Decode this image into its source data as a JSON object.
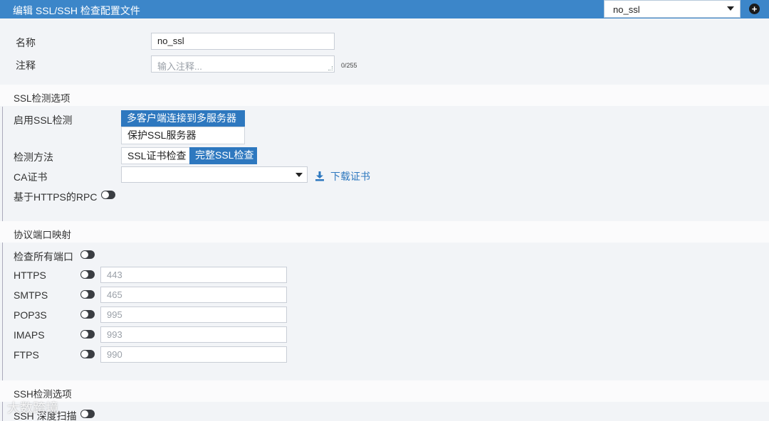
{
  "header": {
    "title": "编辑 SSL/SSH 检查配置文件",
    "profile_select_value": "no_ssl",
    "add_label": "+"
  },
  "form": {
    "name_label": "名称",
    "name_value": "no_ssl",
    "comment_label": "注释",
    "comment_placeholder": "输入注释...",
    "comment_counter": "0/255"
  },
  "ssl_section": {
    "title": "SSL检测选项",
    "enable_label": "启用SSL检测",
    "enable_options": [
      "多客户端连接到多服务器",
      "保护SSL服务器"
    ],
    "enable_selected": "多客户端连接到多服务器",
    "method_label": "检测方法",
    "method_options": [
      "SSL证书检查",
      "完整SSL检查"
    ],
    "method_selected": "完整SSL检查",
    "ca_label": "CA证书",
    "ca_value": "",
    "download_label": "下载证书",
    "rpc_label": "基于HTTPS的RPC"
  },
  "port_section": {
    "title": "协议端口映射",
    "all_ports_label": "检查所有端口",
    "protocols": [
      {
        "name": "HTTPS",
        "port": "443"
      },
      {
        "name": "SMTPS",
        "port": "465"
      },
      {
        "name": "POP3S",
        "port": "995"
      },
      {
        "name": "IMAPS",
        "port": "993"
      },
      {
        "name": "FTPS",
        "port": "990"
      }
    ]
  },
  "ssh_section": {
    "title": "SSH检测选项",
    "deep_scan_label": "SSH 深度扫描"
  },
  "watermark": "大数跨境",
  "colors": {
    "header_bg": "#3c86c9",
    "active_option": "#2e78bf",
    "toggle_off": "#3a3d42",
    "link": "#2e78bf"
  },
  "icons": [
    "plus-circle-icon",
    "chevron-down-icon",
    "download-icon",
    "toggle-icon"
  ]
}
